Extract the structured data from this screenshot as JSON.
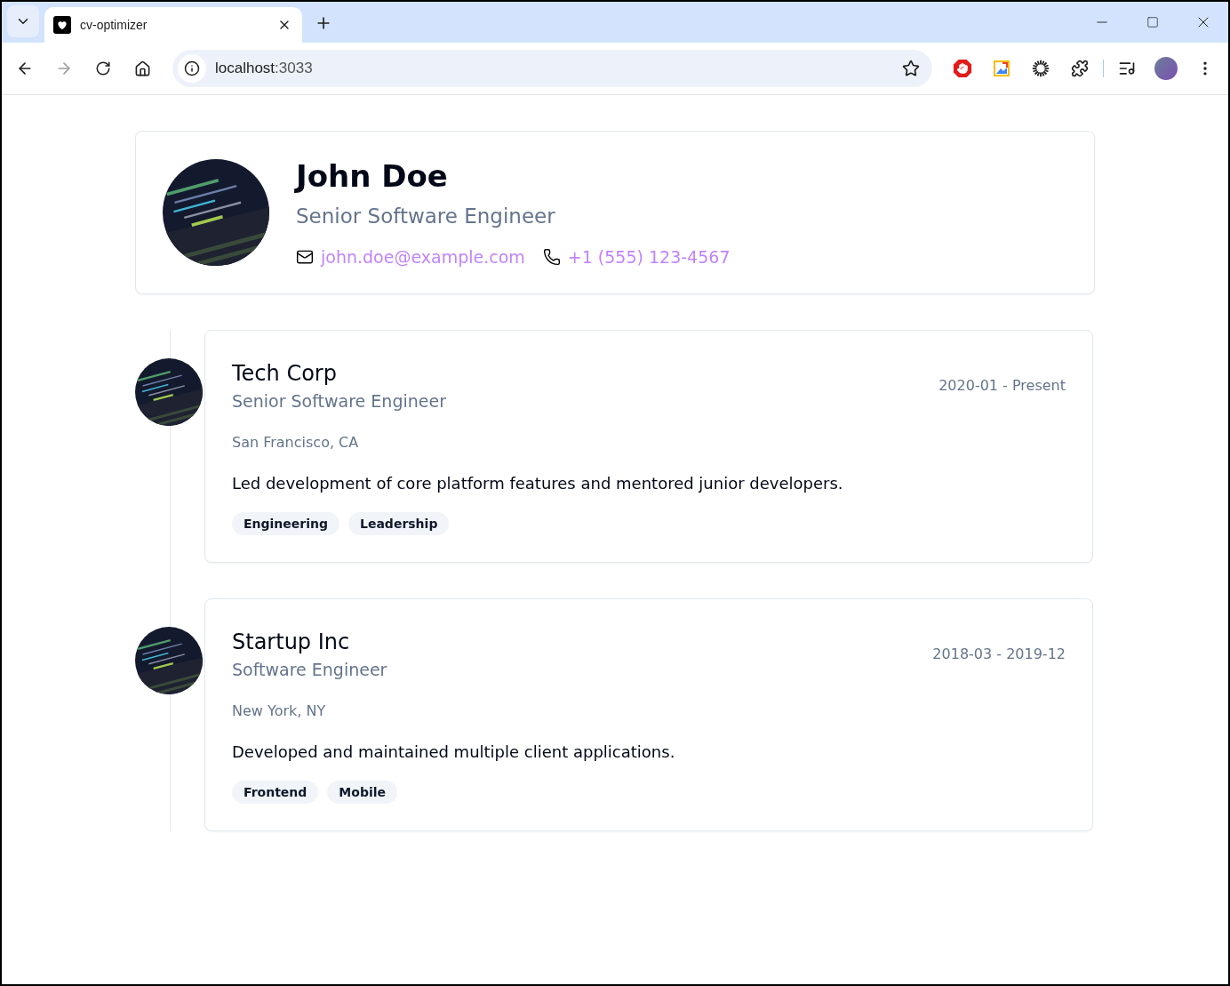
{
  "browser": {
    "tab_title": "cv-optimizer",
    "url_host": "localhost",
    "url_port": ":3033"
  },
  "profile": {
    "name": "John Doe",
    "title": "Senior Software Engineer",
    "email": "john.doe@example.com",
    "phone": "+1 (555) 123-4567"
  },
  "experiences": [
    {
      "company": "Tech Corp",
      "role": "Senior Software Engineer",
      "dates": "2020-01 - Present",
      "location": "San Francisco, CA",
      "description": "Led development of core platform features and mentored junior developers.",
      "tags": [
        "Engineering",
        "Leadership"
      ]
    },
    {
      "company": "Startup Inc",
      "role": "Software Engineer",
      "dates": "2018-03 - 2019-12",
      "location": "New York, NY",
      "description": "Developed and maintained multiple client applications.",
      "tags": [
        "Frontend",
        "Mobile"
      ]
    }
  ]
}
